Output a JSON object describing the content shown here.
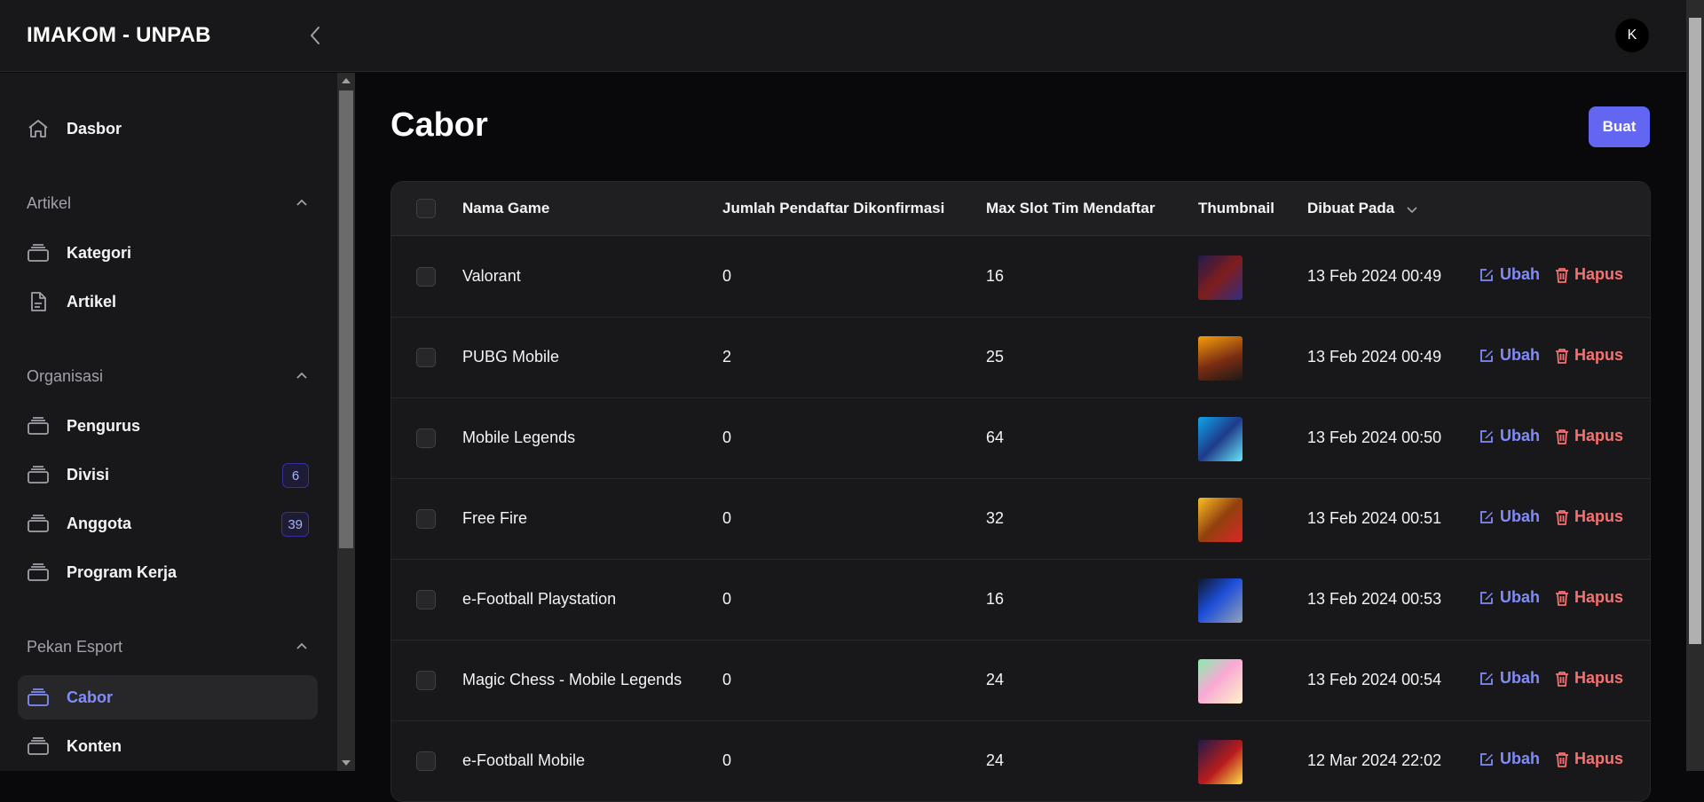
{
  "app": {
    "brand": "IMAKOM - UNPAB",
    "avatar_initial": "K"
  },
  "sidebar": {
    "dashboard": {
      "label": "Dasbor",
      "icon": "home-icon"
    },
    "groups": [
      {
        "label": "Artikel",
        "items": [
          {
            "label": "Kategori",
            "icon": "stack-icon"
          },
          {
            "label": "Artikel",
            "icon": "document-icon"
          }
        ]
      },
      {
        "label": "Organisasi",
        "items": [
          {
            "label": "Pengurus",
            "icon": "stack-icon"
          },
          {
            "label": "Divisi",
            "icon": "stack-icon",
            "badge": "6"
          },
          {
            "label": "Anggota",
            "icon": "stack-icon",
            "badge": "39"
          },
          {
            "label": "Program Kerja",
            "icon": "stack-icon"
          }
        ]
      },
      {
        "label": "Pekan Esport",
        "items": [
          {
            "label": "Cabor",
            "icon": "stack-icon",
            "active": true
          },
          {
            "label": "Konten",
            "icon": "stack-icon"
          }
        ]
      }
    ]
  },
  "main": {
    "title": "Cabor",
    "create_label": "Buat",
    "table": {
      "columns": [
        "Nama Game",
        "Jumlah Pendaftar Dikonfirmasi",
        "Max Slot Tim Mendaftar",
        "Thumbnail",
        "Dibuat Pada"
      ],
      "sorted_column": "Dibuat Pada",
      "edit_label": "Ubah",
      "delete_label": "Hapus",
      "rows": [
        {
          "name": "Valorant",
          "confirmed": "0",
          "max_slot": "16",
          "created_at": "13 Feb 2024 00:49"
        },
        {
          "name": "PUBG Mobile",
          "confirmed": "2",
          "max_slot": "25",
          "created_at": "13 Feb 2024 00:49"
        },
        {
          "name": "Mobile Legends",
          "confirmed": "0",
          "max_slot": "64",
          "created_at": "13 Feb 2024 00:50"
        },
        {
          "name": "Free Fire",
          "confirmed": "0",
          "max_slot": "32",
          "created_at": "13 Feb 2024 00:51"
        },
        {
          "name": "e-Football Playstation",
          "confirmed": "0",
          "max_slot": "16",
          "created_at": "13 Feb 2024 00:53"
        },
        {
          "name": "Magic Chess - Mobile Legends",
          "confirmed": "0",
          "max_slot": "24",
          "created_at": "13 Feb 2024 00:54"
        },
        {
          "name": "e-Football Mobile",
          "confirmed": "0",
          "max_slot": "24",
          "created_at": "12 Mar 2024 22:02"
        }
      ]
    }
  },
  "colors": {
    "accent": "#6366f1",
    "accent_text": "#818cf8",
    "danger": "#f87171",
    "background": "#09090b",
    "panel": "#18181b"
  }
}
